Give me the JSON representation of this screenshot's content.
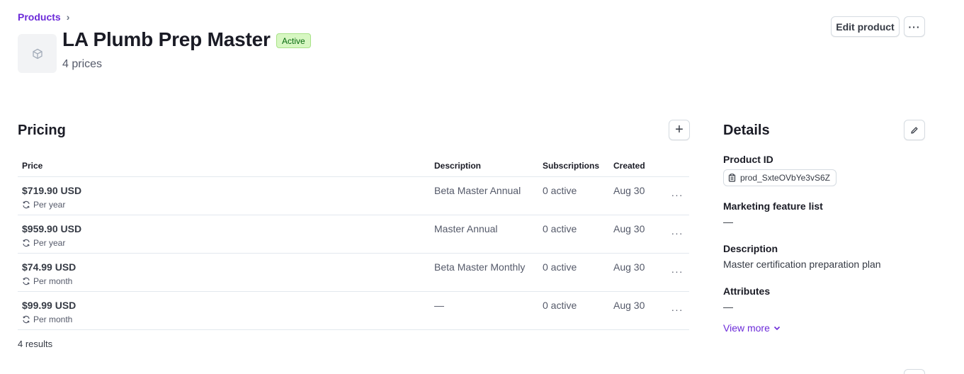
{
  "breadcrumb": {
    "parent": "Products",
    "separator": "›"
  },
  "product": {
    "name": "LA Plumb Prep Master",
    "status": "Active",
    "prices_count": "4 prices",
    "thumbnail_icon": "cube-icon"
  },
  "header_actions": {
    "edit_label": "Edit product",
    "more_label": "···"
  },
  "pricing": {
    "title": "Pricing",
    "add_label": "+",
    "columns": {
      "price": "Price",
      "description": "Description",
      "subscriptions": "Subscriptions",
      "created": "Created"
    },
    "rows": [
      {
        "price": "$719.90 USD",
        "interval": "Per year",
        "description": "Beta Master Annual",
        "subscriptions": "0 active",
        "created": "Aug 30",
        "more": "···"
      },
      {
        "price": "$959.90 USD",
        "interval": "Per year",
        "description": "Master Annual",
        "subscriptions": "0 active",
        "created": "Aug 30",
        "more": "···"
      },
      {
        "price": "$74.99 USD",
        "interval": "Per month",
        "description": "Beta Master Monthly",
        "subscriptions": "0 active",
        "created": "Aug 30",
        "more": "···"
      },
      {
        "price": "$99.99 USD",
        "interval": "Per month",
        "description": "—",
        "subscriptions": "0 active",
        "created": "Aug 30",
        "more": "···"
      }
    ],
    "results": "4 results"
  },
  "details": {
    "title": "Details",
    "product_id_label": "Product ID",
    "product_id": "prod_SxteOVbYe3vS6Z",
    "marketing_label": "Marketing feature list",
    "marketing_value": "—",
    "description_label": "Description",
    "description_value": "Master certification preparation plan",
    "attributes_label": "Attributes",
    "attributes_value": "—",
    "view_more": "View more"
  },
  "colors": {
    "accent": "#6c2bd9",
    "badge_bg": "#d7f7c2",
    "badge_text": "#05690d",
    "border": "#e3e8ee"
  }
}
